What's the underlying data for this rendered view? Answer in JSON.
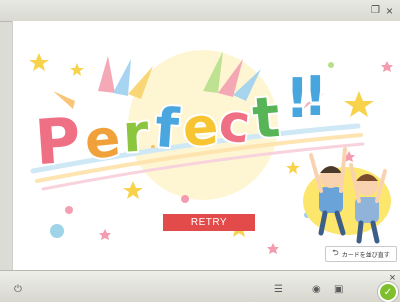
{
  "window": {
    "restore_glyph": "❐",
    "close_glyph": "×"
  },
  "stage": {
    "title_letters": [
      "P",
      "e",
      "r",
      "f",
      "e",
      "c",
      "t",
      "!",
      "!"
    ],
    "retry_label": "RETRY",
    "flip_cards_label": "カードを並び直す"
  },
  "colors": {
    "retry": "#e34a4a",
    "letter_p": "#ef6f85",
    "letter_e1": "#f0a13a",
    "letter_r": "#8cc63f",
    "letter_f": "#4aa6de",
    "letter_e2": "#f7c531",
    "letter_c": "#ef6f85",
    "letter_t": "#58b557",
    "letter_bang": "#48a6df"
  },
  "bottom_bar": {
    "close_glyph": "×",
    "power_icon": "power-icon",
    "list_icon": "list-icon",
    "circle_icon": "circle-icon",
    "square_icon": "square-icon",
    "check_icon": "check-icon"
  }
}
